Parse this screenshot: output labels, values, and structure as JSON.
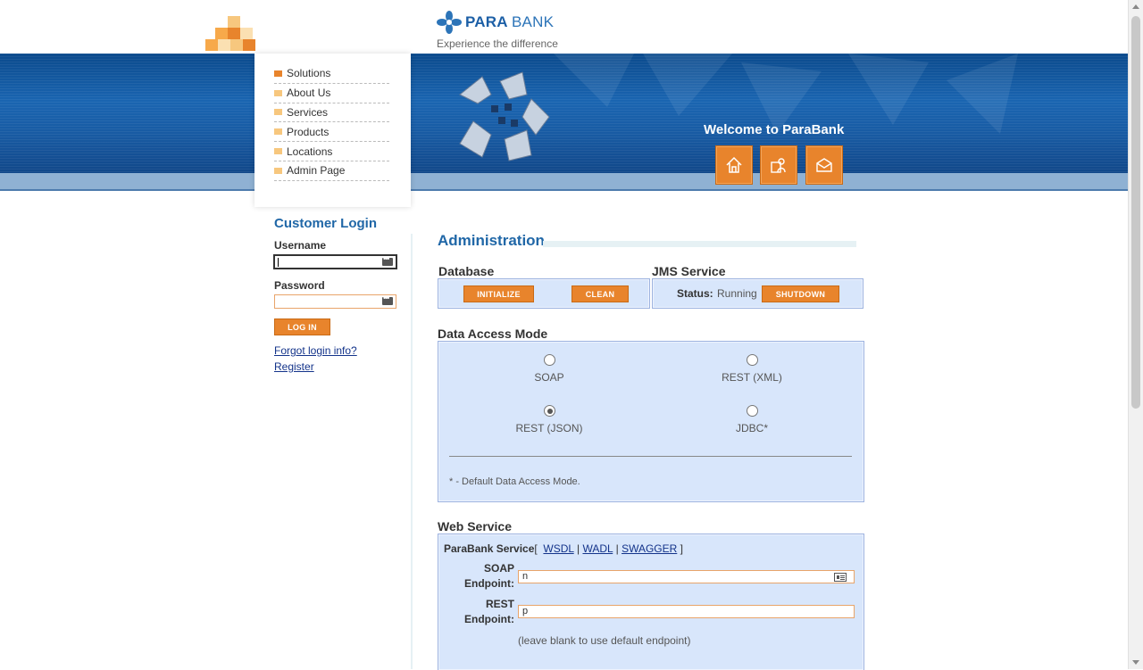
{
  "header": {
    "brand_bold": "PARA",
    "brand_light": "BANK",
    "tagline": "Experience the difference",
    "welcome": "Welcome to ParaBank",
    "icons": [
      "home-icon",
      "about-icon",
      "contact-icon"
    ],
    "colors": {
      "brand": "#1c5fa6",
      "accent": "#e8842c",
      "banner": "#185aa2"
    }
  },
  "menu": {
    "items": [
      {
        "label": "Solutions"
      },
      {
        "label": "About Us"
      },
      {
        "label": "Services"
      },
      {
        "label": "Products"
      },
      {
        "label": "Locations"
      },
      {
        "label": "Admin Page"
      }
    ]
  },
  "login": {
    "title": "Customer Login",
    "username_label": "Username",
    "password_label": "Password",
    "username_value": "",
    "password_value": "",
    "button": "LOG IN",
    "forgot": "Forgot login info?",
    "register": "Register"
  },
  "admin": {
    "title": "Administration",
    "database": {
      "title": "Database",
      "initialize": "INITIALIZE",
      "clean": "CLEAN"
    },
    "jms": {
      "title": "JMS Service",
      "status_label": "Status:",
      "status_value": "Running",
      "shutdown": "SHUTDOWN"
    },
    "data_access": {
      "title": "Data Access Mode",
      "options": [
        {
          "label": "SOAP",
          "checked": false
        },
        {
          "label": "REST (XML)",
          "checked": false
        },
        {
          "label": "REST (JSON)",
          "checked": true
        },
        {
          "label": "JDBC*",
          "checked": false
        }
      ],
      "note": "* - Default Data Access Mode."
    },
    "web_service": {
      "title": "Web Service",
      "service_label": "ParaBank Service",
      "open_bracket": "[",
      "wsdl": "WSDL",
      "sep1": "|",
      "wadl": "WADL",
      "sep2": "|",
      "swagger": "SWAGGER",
      "close_bracket": "]",
      "soap_label_1": "SOAP",
      "soap_label_2": "Endpoint:",
      "soap_value": "n",
      "rest_label_1": "REST",
      "rest_label_2": "Endpoint:",
      "rest_value": "p",
      "hint": "(leave blank to use default endpoint)"
    }
  }
}
